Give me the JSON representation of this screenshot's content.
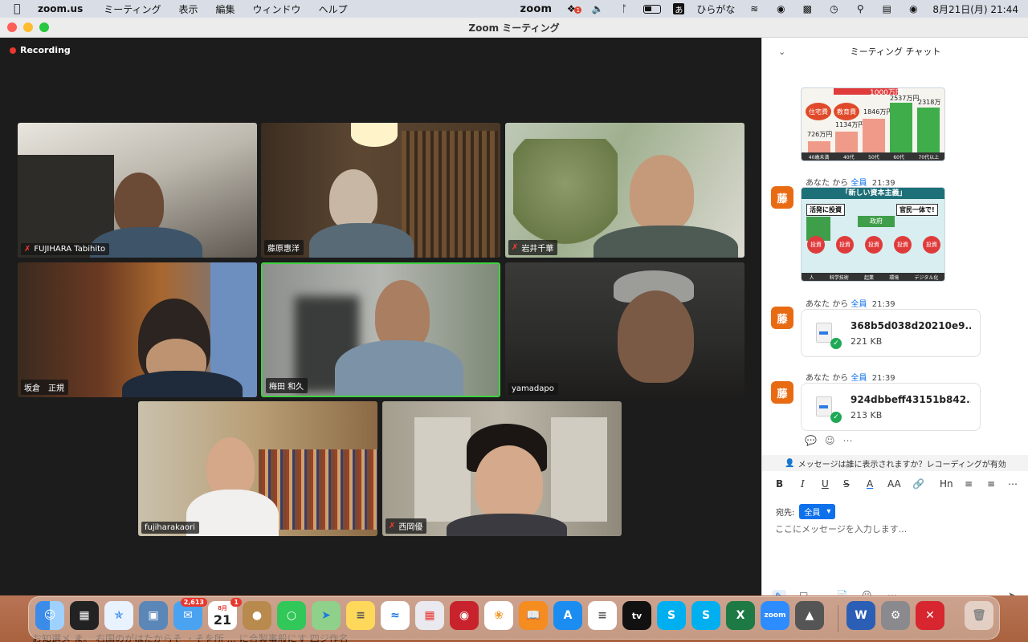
{
  "menubar": {
    "app": "zoom.us",
    "items": [
      "ミーティング",
      "表示",
      "編集",
      "ウィンドウ",
      "ヘルプ"
    ],
    "status": {
      "zoom_label": "zoom",
      "ime_box": "あ",
      "ime_label": "ひらがな",
      "datetime": "8月21日(月)  21:44",
      "notification_count": "1"
    }
  },
  "window": {
    "title": "Zoom ミーティング",
    "recording_label": "Recording"
  },
  "participants": [
    {
      "name": "FUJIHARA Tabihito",
      "muted": true
    },
    {
      "name": "藤原惠洋",
      "muted": false
    },
    {
      "name": "岩井千華",
      "muted": true
    },
    {
      "name": "坂倉　正規",
      "muted": false
    },
    {
      "name": "梅田 和久",
      "muted": false,
      "active_speaker": true
    },
    {
      "name": "yamadapo",
      "muted": false
    },
    {
      "name": "fujiharakaori",
      "muted": false
    },
    {
      "name": "西岡優",
      "muted": true
    }
  ],
  "chat": {
    "title": "ミーティング チャット",
    "image1": {
      "labels": [
        "住宅費",
        "教育費",
        "1000万円"
      ],
      "values": [
        "726万円",
        "1134万円",
        "1846万円",
        "2537万円",
        "2318万円"
      ],
      "ages": [
        "40歳未満",
        "40代",
        "50代",
        "60代",
        "70代以上"
      ]
    },
    "messages": [
      {
        "sender": "あなた",
        "from_word": "から",
        "to": "全員",
        "time": "21:39",
        "avatar": "藤",
        "type": "image",
        "image": {
          "title": "「新しい資本主義」",
          "left": "活発に投資",
          "right": "官民一体で!",
          "center": "政府",
          "icons": [
            "投資",
            "投資",
            "投資",
            "投資",
            "投資"
          ],
          "bottom": [
            "人",
            "科学技術",
            "起業",
            "環境",
            "デジタル化"
          ]
        }
      },
      {
        "sender": "あなた",
        "from_word": "から",
        "to": "全員",
        "time": "21:39",
        "avatar": "藤",
        "type": "file",
        "file_name": "368b5d038d20210e9...",
        "file_size": "221 KB"
      },
      {
        "sender": "あなた",
        "from_word": "から",
        "to": "全員",
        "time": "21:39",
        "avatar": "藤",
        "type": "file",
        "file_name": "924dbbeff43151b842...",
        "file_size": "213 KB"
      }
    ],
    "notice": "メッセージは誰に表示されますか？レコーディングが有効",
    "toolbar": [
      "B",
      "I",
      "U",
      "S",
      "A",
      "AA",
      "link-icon",
      "Hn",
      "list-icon",
      "numbered-list-icon",
      "more-icon"
    ],
    "to_label": "宛先:",
    "to_value": "全員",
    "compose_placeholder": "ここにメッセージを入力します..."
  },
  "dock": {
    "mail_badge": "2,613",
    "calendar_month": "8月",
    "calendar_day": "21",
    "calendar_badge": "1",
    "apps": [
      "Finder",
      "Mission Control",
      "Safari",
      "Preview",
      "Mail",
      "Calendar",
      "Contacts",
      "Messages",
      "Maps",
      "Notes",
      "Freeform",
      "Launchpad",
      "Photo Booth",
      "Photos",
      "Books",
      "App Store",
      "Reminders",
      "TV",
      "Skype",
      "Skype",
      "Excel",
      "Zoom",
      "Drive",
      "Word",
      "System Settings",
      "Trend Micro",
      "Trash"
    ],
    "tv_label": "tv",
    "zoom_label": "zoom",
    "background_text": "お知選メ ま。 右国のがはたからそ ・そを所 ... に合製事般にす 四ジ作名"
  }
}
